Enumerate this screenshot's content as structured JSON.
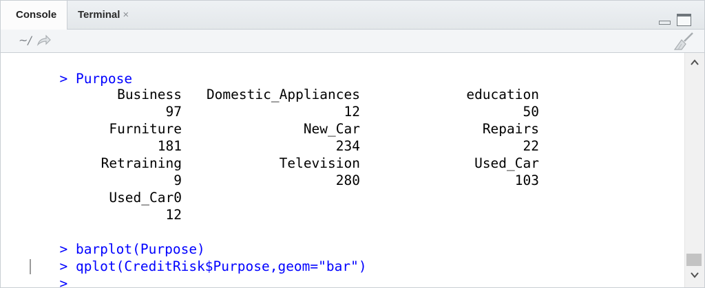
{
  "tabs": {
    "console_label": "Console",
    "terminal_label": "Terminal",
    "close_glyph": "×"
  },
  "toolbar": {
    "working_dir": "~/",
    "icons": [
      "go-to-directory-arrow-icon",
      "clear-console-broom-icon"
    ]
  },
  "console": {
    "prompt": ">",
    "cmd_purpose": "Purpose",
    "table": {
      "row1_names": [
        "Business",
        "Domestic_Appliances",
        "education"
      ],
      "row1_values": [
        "97",
        "12",
        "50"
      ],
      "row2_names": [
        "Furniture",
        "New_Car",
        "Repairs"
      ],
      "row2_values": [
        "181",
        "234",
        "22"
      ],
      "row3_names": [
        "Retraining",
        "Television",
        "Used_Car"
      ],
      "row3_values": [
        "9",
        "280",
        "103"
      ],
      "row4_names": [
        "Used_Car0"
      ],
      "row4_values": [
        "12"
      ]
    },
    "cmd_barplot": "barplot(Purpose)",
    "cmd_qplot": "qplot(CreditRisk$Purpose,geom=\"bar\")"
  },
  "colors": {
    "command_text": "#0000ff",
    "output_text": "#000000",
    "tab_bar_bg": "#e8ecef",
    "border": "#c9ced3"
  }
}
